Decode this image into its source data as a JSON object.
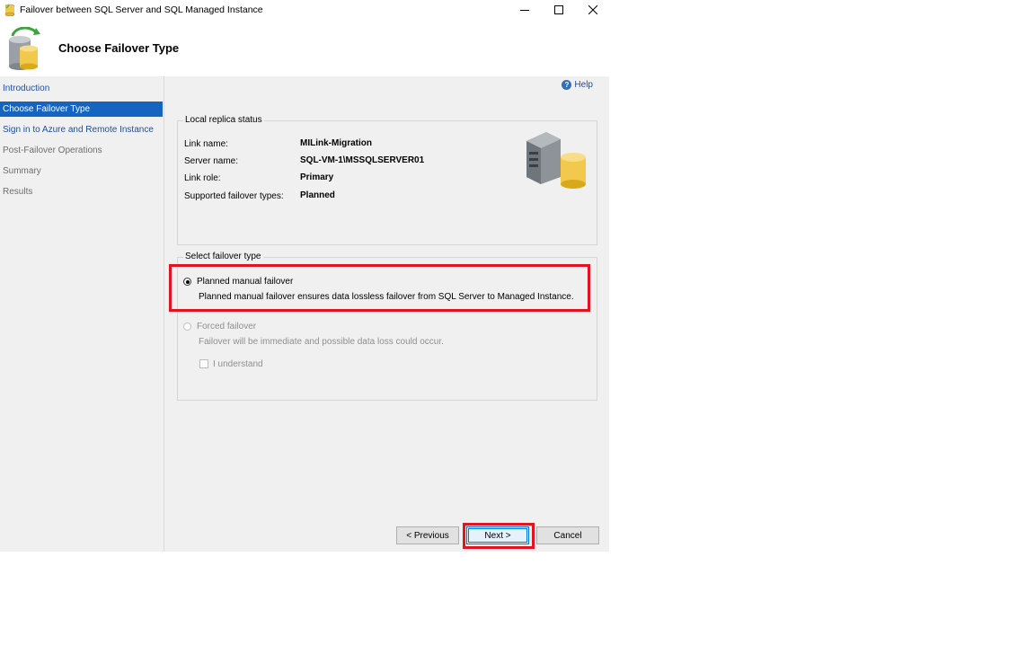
{
  "window": {
    "title": "Failover between SQL Server and SQL Managed Instance",
    "controls": [
      "minimize-icon",
      "maximize-icon",
      "close-icon"
    ]
  },
  "header": {
    "page_title": "Choose Failover Type",
    "icon": "database-refresh-icon"
  },
  "sidebar": {
    "items": [
      {
        "label": "Introduction",
        "state": "link"
      },
      {
        "label": "Choose Failover Type",
        "state": "active"
      },
      {
        "label": "Sign in to Azure and Remote Instance",
        "state": "link"
      },
      {
        "label": "Post-Failover Operations",
        "state": "disabled"
      },
      {
        "label": "Summary",
        "state": "disabled"
      },
      {
        "label": "Results",
        "state": "disabled"
      }
    ]
  },
  "help": {
    "label": "Help",
    "icon": "help-icon"
  },
  "replica_status": {
    "group_label": "Local replica status",
    "rows": [
      {
        "label": "Link name:",
        "value": "MILink-Migration"
      },
      {
        "label": "Server name:",
        "value": "SQL-VM-1\\MSSQLSERVER01"
      },
      {
        "label": "Link role:",
        "value": "Primary"
      },
      {
        "label": "Supported failover types:",
        "value": "Planned"
      }
    ],
    "icon": "server-database-icon"
  },
  "failover_type": {
    "group_label": "Select failover type",
    "planned": {
      "label": "Planned manual failover",
      "description": "Planned manual failover ensures data lossless failover from SQL Server to Managed Instance.",
      "checked": true
    },
    "forced": {
      "label": "Forced failover",
      "description": "Failover will be immediate and possible data loss could occur.",
      "checked": false,
      "enabled": false
    },
    "understand": {
      "label": "I understand",
      "checked": false,
      "enabled": false
    }
  },
  "buttons": {
    "previous": "< Previous",
    "next": "Next >",
    "cancel": "Cancel"
  },
  "colors": {
    "highlight": "#e2141e",
    "active_nav": "#1565c0",
    "link": "#1f4e9c"
  }
}
